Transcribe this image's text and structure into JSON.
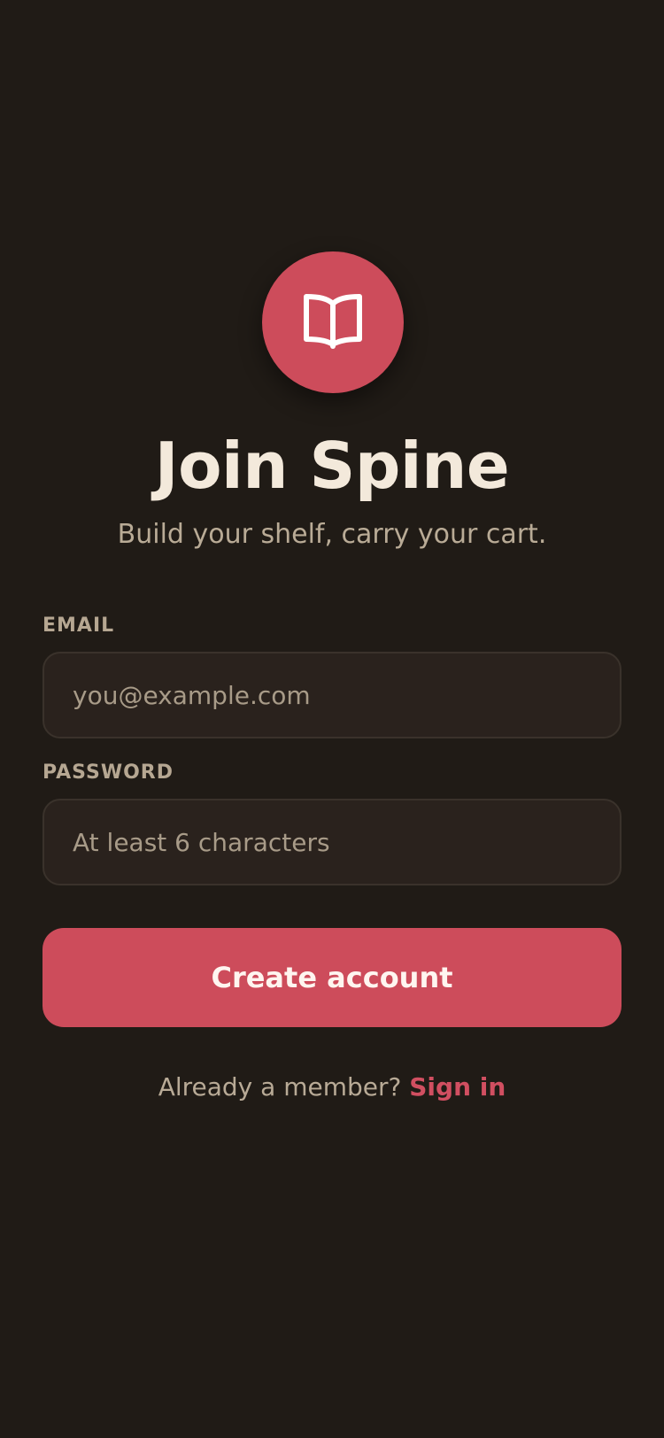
{
  "app": {
    "logo_icon": "open-book-icon",
    "title": "Join Spine",
    "subtitle": "Build your shelf, carry your cart."
  },
  "form": {
    "email": {
      "label": "EMAIL",
      "value": "",
      "placeholder": "you@example.com"
    },
    "password": {
      "label": "PASSWORD",
      "value": "",
      "placeholder": "At least 6 characters"
    },
    "submit_label": "Create account"
  },
  "footer": {
    "prompt": "Already a member? ",
    "link_label": "Sign in"
  },
  "colors": {
    "background": "#201b16",
    "accent": "#cd4c5b",
    "field_background": "#2a221d",
    "text_primary": "#f3e9db",
    "text_muted": "#b9ab96"
  }
}
